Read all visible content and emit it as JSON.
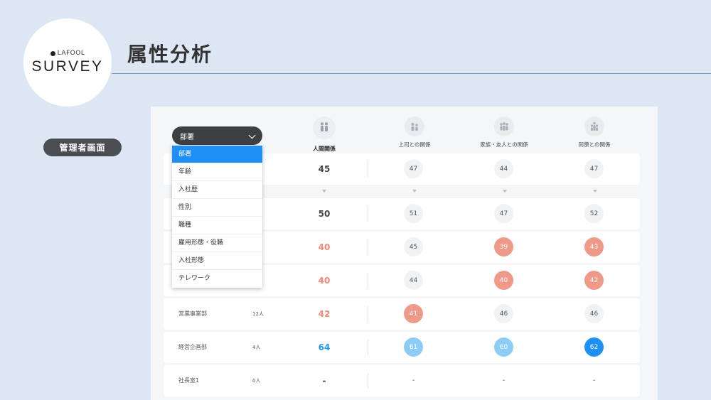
{
  "logo": {
    "small_text": "LAFOOL",
    "big_text": "SURVEY"
  },
  "page_title": "属性分析",
  "admin_badge": "管理者画面",
  "colors": {
    "accent_blue": "#1e8ff5",
    "light_blue": "#8dcdf5",
    "salmon": "#ef9a88",
    "neutral": "#f0f2f4",
    "text_salmon": "#ef8a79",
    "text_blue": "#2196f3"
  },
  "select": {
    "current": "部署",
    "options": [
      "部署",
      "年齢",
      "入社歴",
      "性別",
      "職種",
      "雇用形態・役職",
      "入社形態",
      "テレワーク"
    ],
    "selected_index": 0
  },
  "columns": [
    {
      "label": "人間関係",
      "icon": "people-pair-icon"
    },
    {
      "label": "上司との関係",
      "icon": "boss-icon"
    },
    {
      "label": "家族・友人との関係",
      "icon": "family-icon"
    },
    {
      "label": "同僚との関係",
      "icon": "colleagues-icon"
    }
  ],
  "rows": [
    {
      "dept": "",
      "count": "",
      "main": {
        "value": "45",
        "tone": "neutral"
      },
      "cells": [
        {
          "value": "47",
          "tone": "neutral"
        },
        {
          "value": "44",
          "tone": "neutral"
        },
        {
          "value": "47",
          "tone": "neutral"
        }
      ]
    },
    {
      "dept": "",
      "count": "",
      "main": {
        "value": "50",
        "tone": "neutral"
      },
      "cells": [
        {
          "value": "51",
          "tone": "neutral"
        },
        {
          "value": "47",
          "tone": "neutral"
        },
        {
          "value": "52",
          "tone": "neutral"
        }
      ]
    },
    {
      "dept": "",
      "count": "",
      "main": {
        "value": "40",
        "tone": "salmon"
      },
      "cells": [
        {
          "value": "45",
          "tone": "neutral"
        },
        {
          "value": "39",
          "tone": "salmon"
        },
        {
          "value": "43",
          "tone": "salmon"
        }
      ]
    },
    {
      "dept": "",
      "count": "",
      "main": {
        "value": "40",
        "tone": "salmon"
      },
      "cells": [
        {
          "value": "44",
          "tone": "neutral"
        },
        {
          "value": "40",
          "tone": "salmon"
        },
        {
          "value": "42",
          "tone": "salmon"
        }
      ]
    },
    {
      "dept": "営業事業部",
      "count": "12人",
      "main": {
        "value": "42",
        "tone": "salmon"
      },
      "cells": [
        {
          "value": "41",
          "tone": "salmon"
        },
        {
          "value": "46",
          "tone": "neutral"
        },
        {
          "value": "46",
          "tone": "neutral"
        }
      ]
    },
    {
      "dept": "経営企画部",
      "count": "4人",
      "main": {
        "value": "64",
        "tone": "blue"
      },
      "cells": [
        {
          "value": "61",
          "tone": "lightblue"
        },
        {
          "value": "60",
          "tone": "lightblue"
        },
        {
          "value": "62",
          "tone": "blue"
        }
      ]
    },
    {
      "dept": "社長室1",
      "count": "0人",
      "main": {
        "value": "-",
        "tone": "none"
      },
      "cells": [
        {
          "value": "-",
          "tone": "none"
        },
        {
          "value": "-",
          "tone": "none"
        },
        {
          "value": "-",
          "tone": "none"
        }
      ]
    }
  ]
}
